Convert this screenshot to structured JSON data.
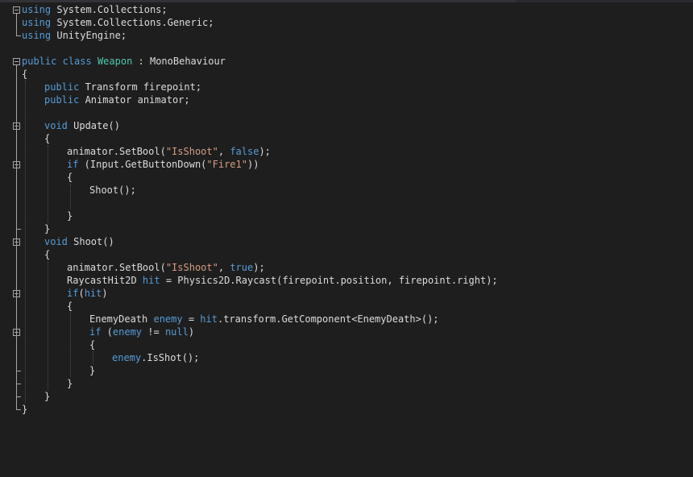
{
  "editor": {
    "colors": {
      "background": "#1e1e1e",
      "keyword": "#569cd6",
      "type": "#4ec9b0",
      "string": "#d69d85",
      "plain": "#dcdcdc",
      "fold_marker": "#a5a5a5"
    },
    "fold_marker_icon": "collapse-minus-icon",
    "lines": [
      {
        "indent": 27,
        "tokens": [
          {
            "t": "kw",
            "v": "using"
          },
          {
            "t": "pl",
            "v": " System.Collections;"
          }
        ]
      },
      {
        "indent": 27,
        "tokens": [
          {
            "t": "kw",
            "v": "using"
          },
          {
            "t": "pl",
            "v": " System.Collections.Generic;"
          }
        ]
      },
      {
        "indent": 27,
        "tokens": [
          {
            "t": "kw",
            "v": "using"
          },
          {
            "t": "pl",
            "v": " UnityEngine;"
          }
        ]
      },
      {
        "indent": 27,
        "tokens": []
      },
      {
        "indent": 27,
        "tokens": [
          {
            "t": "kw",
            "v": "public"
          },
          {
            "t": "pl",
            "v": " "
          },
          {
            "t": "kw",
            "v": "class"
          },
          {
            "t": "pl",
            "v": " "
          },
          {
            "t": "ty",
            "v": "Weapon"
          },
          {
            "t": "pl",
            "v": " : MonoBehaviour"
          }
        ]
      },
      {
        "indent": 27,
        "tokens": [
          {
            "t": "pl",
            "v": "{"
          }
        ]
      },
      {
        "indent": 55,
        "tokens": [
          {
            "t": "kw",
            "v": "public"
          },
          {
            "t": "pl",
            "v": " Transform firepoint;"
          }
        ]
      },
      {
        "indent": 55,
        "tokens": [
          {
            "t": "kw",
            "v": "public"
          },
          {
            "t": "pl",
            "v": " Animator animator;"
          }
        ]
      },
      {
        "indent": 27,
        "tokens": []
      },
      {
        "indent": 55,
        "tokens": [
          {
            "t": "kw",
            "v": "void"
          },
          {
            "t": "pl",
            "v": " Update()"
          }
        ]
      },
      {
        "indent": 55,
        "tokens": [
          {
            "t": "pl",
            "v": "{"
          }
        ]
      },
      {
        "indent": 83,
        "tokens": [
          {
            "t": "pl",
            "v": "animator.SetBool("
          },
          {
            "t": "st",
            "v": "\"IsShoot\""
          },
          {
            "t": "pl",
            "v": ", "
          },
          {
            "t": "kw",
            "v": "false"
          },
          {
            "t": "pl",
            "v": ");"
          }
        ]
      },
      {
        "indent": 83,
        "tokens": [
          {
            "t": "kw",
            "v": "if"
          },
          {
            "t": "pl",
            "v": " (Input.GetButtonDown("
          },
          {
            "t": "st",
            "v": "\"Fire1\""
          },
          {
            "t": "pl",
            "v": "))"
          }
        ]
      },
      {
        "indent": 83,
        "tokens": [
          {
            "t": "pl",
            "v": "{"
          }
        ]
      },
      {
        "indent": 111,
        "tokens": [
          {
            "t": "pl",
            "v": "Shoot();"
          }
        ]
      },
      {
        "indent": 27,
        "tokens": []
      },
      {
        "indent": 83,
        "tokens": [
          {
            "t": "pl",
            "v": "}"
          }
        ]
      },
      {
        "indent": 55,
        "tokens": [
          {
            "t": "pl",
            "v": "}"
          }
        ]
      },
      {
        "indent": 55,
        "tokens": [
          {
            "t": "kw",
            "v": "void"
          },
          {
            "t": "pl",
            "v": " Shoot()"
          }
        ]
      },
      {
        "indent": 55,
        "tokens": [
          {
            "t": "pl",
            "v": "{"
          }
        ]
      },
      {
        "indent": 83,
        "tokens": [
          {
            "t": "pl",
            "v": "animator.SetBool("
          },
          {
            "t": "st",
            "v": "\"IsShoot\""
          },
          {
            "t": "pl",
            "v": ", "
          },
          {
            "t": "kw",
            "v": "true"
          },
          {
            "t": "pl",
            "v": ");"
          }
        ]
      },
      {
        "indent": 83,
        "tokens": [
          {
            "t": "pl",
            "v": "RaycastHit2D "
          },
          {
            "t": "kw",
            "v": "hit"
          },
          {
            "t": "pl",
            "v": " = Physics2D.Raycast(firepoint.position, firepoint.right);"
          }
        ]
      },
      {
        "indent": 83,
        "tokens": [
          {
            "t": "kw",
            "v": "if"
          },
          {
            "t": "pl",
            "v": "("
          },
          {
            "t": "kw",
            "v": "hit"
          },
          {
            "t": "pl",
            "v": ")"
          }
        ]
      },
      {
        "indent": 83,
        "tokens": [
          {
            "t": "pl",
            "v": "{"
          }
        ]
      },
      {
        "indent": 111,
        "tokens": [
          {
            "t": "pl",
            "v": "EnemyDeath "
          },
          {
            "t": "kw",
            "v": "enemy"
          },
          {
            "t": "pl",
            "v": " = "
          },
          {
            "t": "kw",
            "v": "hit"
          },
          {
            "t": "pl",
            "v": ".transform.GetComponent<EnemyDeath>();"
          }
        ]
      },
      {
        "indent": 111,
        "tokens": [
          {
            "t": "kw",
            "v": "if"
          },
          {
            "t": "pl",
            "v": " ("
          },
          {
            "t": "kw",
            "v": "enemy"
          },
          {
            "t": "pl",
            "v": " != "
          },
          {
            "t": "kw",
            "v": "null"
          },
          {
            "t": "pl",
            "v": ")"
          }
        ]
      },
      {
        "indent": 111,
        "tokens": [
          {
            "t": "pl",
            "v": "{"
          }
        ]
      },
      {
        "indent": 139,
        "tokens": [
          {
            "t": "kw",
            "v": "enemy"
          },
          {
            "t": "pl",
            "v": ".IsShot();"
          }
        ]
      },
      {
        "indent": 111,
        "tokens": [
          {
            "t": "pl",
            "v": "}"
          }
        ]
      },
      {
        "indent": 83,
        "tokens": [
          {
            "t": "pl",
            "v": "}"
          }
        ]
      },
      {
        "indent": 55,
        "tokens": [
          {
            "t": "pl",
            "v": "}"
          }
        ]
      },
      {
        "indent": 27,
        "tokens": [
          {
            "t": "pl",
            "v": "}"
          }
        ]
      }
    ]
  }
}
